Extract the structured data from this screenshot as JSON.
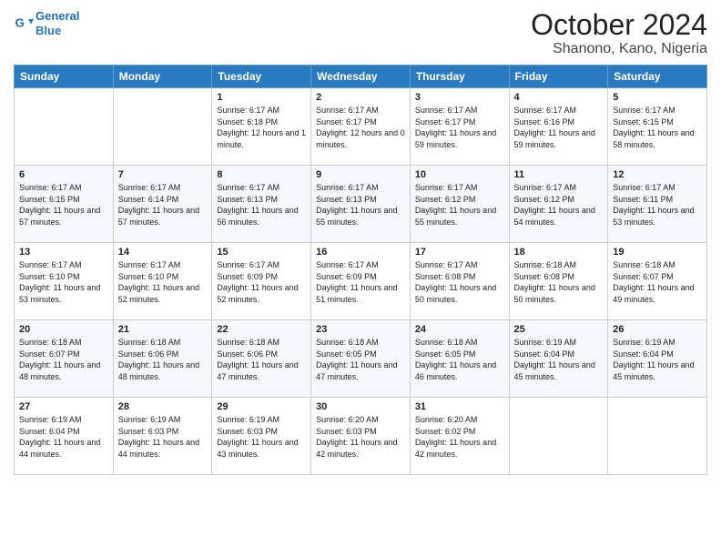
{
  "logo": {
    "line1": "General",
    "line2": "Blue"
  },
  "title": "October 2024",
  "location": "Shanono, Kano, Nigeria",
  "days_of_week": [
    "Sunday",
    "Monday",
    "Tuesday",
    "Wednesday",
    "Thursday",
    "Friday",
    "Saturday"
  ],
  "weeks": [
    [
      {
        "day": "",
        "text": ""
      },
      {
        "day": "",
        "text": ""
      },
      {
        "day": "1",
        "text": "Sunrise: 6:17 AM\nSunset: 6:18 PM\nDaylight: 12 hours and 1 minute."
      },
      {
        "day": "2",
        "text": "Sunrise: 6:17 AM\nSunset: 6:17 PM\nDaylight: 12 hours and 0 minutes."
      },
      {
        "day": "3",
        "text": "Sunrise: 6:17 AM\nSunset: 6:17 PM\nDaylight: 11 hours and 59 minutes."
      },
      {
        "day": "4",
        "text": "Sunrise: 6:17 AM\nSunset: 6:16 PM\nDaylight: 11 hours and 59 minutes."
      },
      {
        "day": "5",
        "text": "Sunrise: 6:17 AM\nSunset: 6:15 PM\nDaylight: 11 hours and 58 minutes."
      }
    ],
    [
      {
        "day": "6",
        "text": "Sunrise: 6:17 AM\nSunset: 6:15 PM\nDaylight: 11 hours and 57 minutes."
      },
      {
        "day": "7",
        "text": "Sunrise: 6:17 AM\nSunset: 6:14 PM\nDaylight: 11 hours and 57 minutes."
      },
      {
        "day": "8",
        "text": "Sunrise: 6:17 AM\nSunset: 6:13 PM\nDaylight: 11 hours and 56 minutes."
      },
      {
        "day": "9",
        "text": "Sunrise: 6:17 AM\nSunset: 6:13 PM\nDaylight: 11 hours and 55 minutes."
      },
      {
        "day": "10",
        "text": "Sunrise: 6:17 AM\nSunset: 6:12 PM\nDaylight: 11 hours and 55 minutes."
      },
      {
        "day": "11",
        "text": "Sunrise: 6:17 AM\nSunset: 6:12 PM\nDaylight: 11 hours and 54 minutes."
      },
      {
        "day": "12",
        "text": "Sunrise: 6:17 AM\nSunset: 6:11 PM\nDaylight: 11 hours and 53 minutes."
      }
    ],
    [
      {
        "day": "13",
        "text": "Sunrise: 6:17 AM\nSunset: 6:10 PM\nDaylight: 11 hours and 53 minutes."
      },
      {
        "day": "14",
        "text": "Sunrise: 6:17 AM\nSunset: 6:10 PM\nDaylight: 11 hours and 52 minutes."
      },
      {
        "day": "15",
        "text": "Sunrise: 6:17 AM\nSunset: 6:09 PM\nDaylight: 11 hours and 52 minutes."
      },
      {
        "day": "16",
        "text": "Sunrise: 6:17 AM\nSunset: 6:09 PM\nDaylight: 11 hours and 51 minutes."
      },
      {
        "day": "17",
        "text": "Sunrise: 6:17 AM\nSunset: 6:08 PM\nDaylight: 11 hours and 50 minutes."
      },
      {
        "day": "18",
        "text": "Sunrise: 6:18 AM\nSunset: 6:08 PM\nDaylight: 11 hours and 50 minutes."
      },
      {
        "day": "19",
        "text": "Sunrise: 6:18 AM\nSunset: 6:07 PM\nDaylight: 11 hours and 49 minutes."
      }
    ],
    [
      {
        "day": "20",
        "text": "Sunrise: 6:18 AM\nSunset: 6:07 PM\nDaylight: 11 hours and 48 minutes."
      },
      {
        "day": "21",
        "text": "Sunrise: 6:18 AM\nSunset: 6:06 PM\nDaylight: 11 hours and 48 minutes."
      },
      {
        "day": "22",
        "text": "Sunrise: 6:18 AM\nSunset: 6:06 PM\nDaylight: 11 hours and 47 minutes."
      },
      {
        "day": "23",
        "text": "Sunrise: 6:18 AM\nSunset: 6:05 PM\nDaylight: 11 hours and 47 minutes."
      },
      {
        "day": "24",
        "text": "Sunrise: 6:18 AM\nSunset: 6:05 PM\nDaylight: 11 hours and 46 minutes."
      },
      {
        "day": "25",
        "text": "Sunrise: 6:19 AM\nSunset: 6:04 PM\nDaylight: 11 hours and 45 minutes."
      },
      {
        "day": "26",
        "text": "Sunrise: 6:19 AM\nSunset: 6:04 PM\nDaylight: 11 hours and 45 minutes."
      }
    ],
    [
      {
        "day": "27",
        "text": "Sunrise: 6:19 AM\nSunset: 6:04 PM\nDaylight: 11 hours and 44 minutes."
      },
      {
        "day": "28",
        "text": "Sunrise: 6:19 AM\nSunset: 6:03 PM\nDaylight: 11 hours and 44 minutes."
      },
      {
        "day": "29",
        "text": "Sunrise: 6:19 AM\nSunset: 6:03 PM\nDaylight: 11 hours and 43 minutes."
      },
      {
        "day": "30",
        "text": "Sunrise: 6:20 AM\nSunset: 6:03 PM\nDaylight: 11 hours and 42 minutes."
      },
      {
        "day": "31",
        "text": "Sunrise: 6:20 AM\nSunset: 6:02 PM\nDaylight: 11 hours and 42 minutes."
      },
      {
        "day": "",
        "text": ""
      },
      {
        "day": "",
        "text": ""
      }
    ]
  ]
}
